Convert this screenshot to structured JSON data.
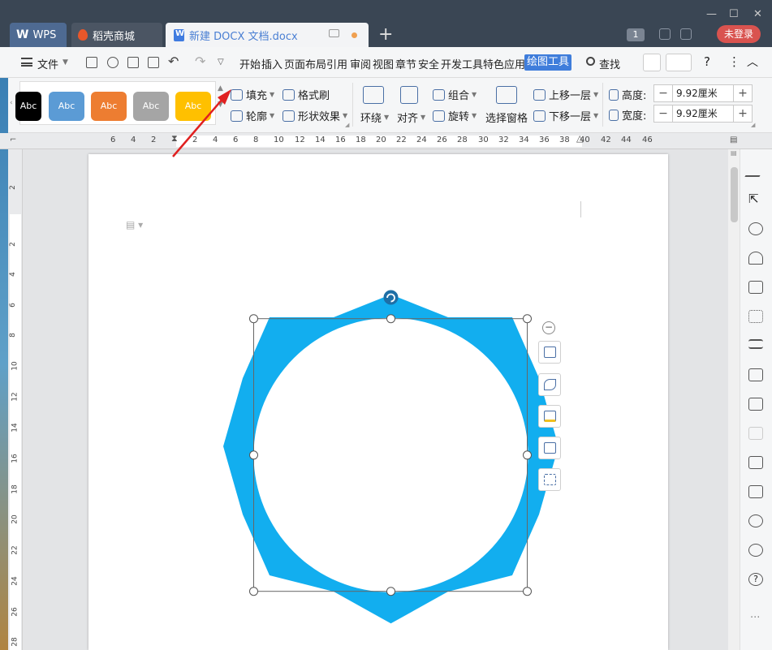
{
  "titlebar": {
    "tabs": [
      {
        "label": "WPS"
      },
      {
        "label": "稻壳商城"
      },
      {
        "label": "新建 DOCX 文档.docx"
      }
    ],
    "window_count": "1",
    "login_label": "未登录"
  },
  "menubar": {
    "file_label": "文件",
    "items": [
      "开始",
      "插入",
      "页面布局",
      "引用",
      "审阅",
      "视图",
      "章节",
      "安全",
      "开发工具",
      "特色应用"
    ],
    "active_tab": "绘图工具",
    "find_label": "查找"
  },
  "ribbon": {
    "style_presets": [
      {
        "label": "Abc",
        "color": "#000000"
      },
      {
        "label": "Abc",
        "color": "#5b9bd5"
      },
      {
        "label": "Abc",
        "color": "#ed7d31"
      },
      {
        "label": "Abc",
        "color": "#a5a5a5"
      },
      {
        "label": "Abc",
        "color": "#ffc000"
      }
    ],
    "fill": "填充",
    "format_painter": "格式刷",
    "outline": "轮廓",
    "shape_effects": "形状效果",
    "wrap": "环绕",
    "align": "对齐",
    "group": "组合",
    "rotate": "旋转",
    "selection_pane": "选择窗格",
    "bring_forward": "上移一层",
    "send_backward": "下移一层",
    "height_label": "高度:",
    "height_value": "9.92厘米",
    "width_label": "宽度:",
    "width_value": "9.92厘米"
  },
  "hruler": {
    "ticks": [
      "6",
      "4",
      "2",
      "2",
      "4",
      "6",
      "8",
      "10",
      "12",
      "14",
      "16",
      "18",
      "20",
      "22",
      "24",
      "26",
      "28",
      "30",
      "32",
      "34",
      "36",
      "38",
      "40",
      "42",
      "44",
      "46"
    ]
  },
  "vruler": {
    "ticks": [
      "2",
      "2",
      "4",
      "6",
      "8",
      "10",
      "12",
      "14",
      "16",
      "18",
      "20",
      "22",
      "24",
      "26",
      "28"
    ]
  },
  "shape": {
    "fill_color": "#12aeef",
    "inner_color": "#ffffff"
  },
  "colors": {
    "accent": "#3f7ddb",
    "login": "#d9534f",
    "arrow": "#e02020"
  }
}
